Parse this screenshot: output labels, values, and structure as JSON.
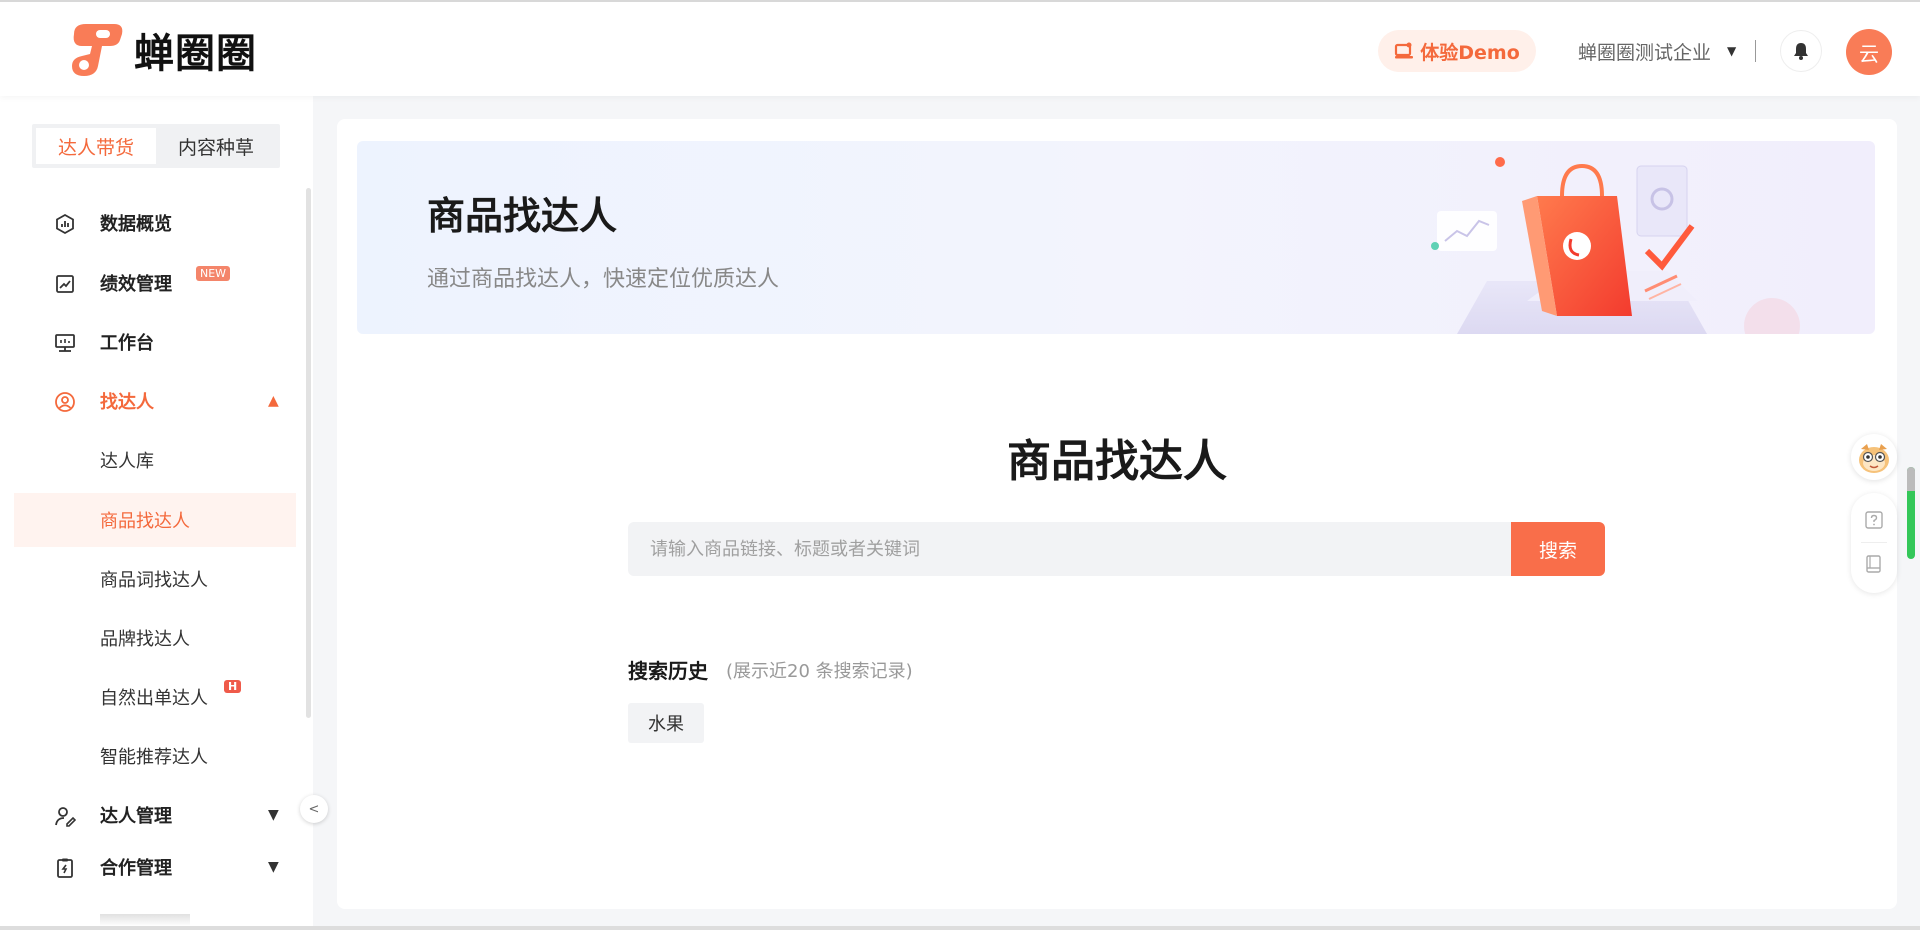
{
  "header": {
    "logo_text": "蝉圈圈",
    "demo_label": "体验Demo",
    "company_name": "蝉圈圈测试企业",
    "avatar_text": "云",
    "accent": "#f4693c"
  },
  "sidebar": {
    "segments": [
      {
        "label": "达人带货",
        "active": true
      },
      {
        "label": "内容种草",
        "active": false
      }
    ],
    "items": [
      {
        "label": "数据概览",
        "icon": "gauge-icon"
      },
      {
        "label": "绩效管理",
        "icon": "trend-chart-icon",
        "badge": "NEW"
      },
      {
        "label": "工作台",
        "icon": "monitor-icon"
      },
      {
        "label": "找达人",
        "icon": "user-circle-icon",
        "expanded": true
      },
      {
        "label": "达人管理",
        "icon": "user-edit-icon"
      },
      {
        "label": "合作管理",
        "icon": "clipboard-icon"
      }
    ],
    "sub_items": [
      {
        "label": "达人库"
      },
      {
        "label": "商品找达人",
        "active": true
      },
      {
        "label": "商品词找达人"
      },
      {
        "label": "品牌找达人"
      },
      {
        "label": "自然出单达人",
        "badge": "H"
      },
      {
        "label": "智能推荐达人"
      }
    ]
  },
  "main": {
    "banner_title": "商品找达人",
    "banner_subtitle": "通过商品找达人，快速定位优质达人",
    "page_title": "商品找达人",
    "search": {
      "placeholder": "请输入商品链接、标题或者关键词",
      "value": "",
      "button_label": "搜索"
    },
    "history": {
      "title": "搜索历史",
      "note": "(展示近20 条搜索记录)",
      "tags": [
        "水果"
      ]
    }
  }
}
